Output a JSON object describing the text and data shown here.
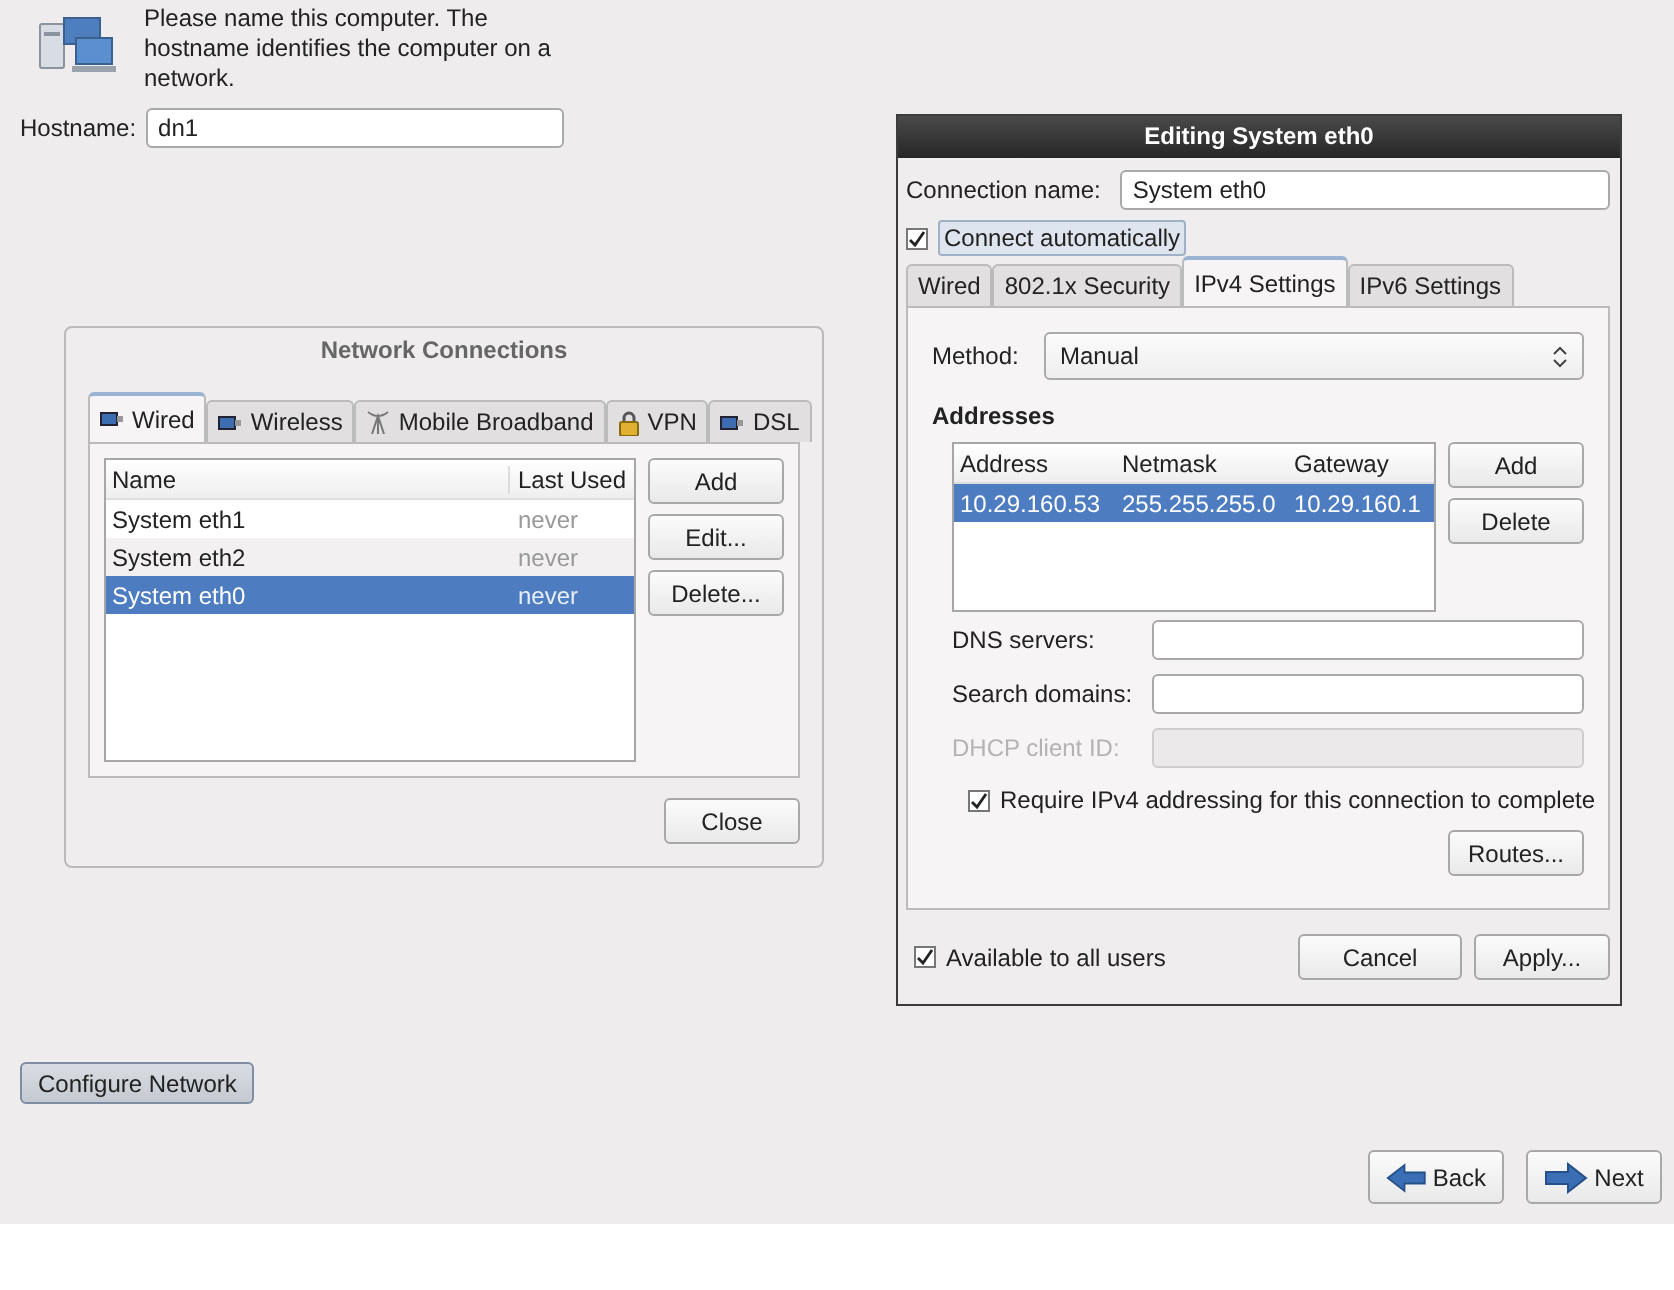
{
  "header": {
    "message": "Please name this computer.  The hostname identifies the computer on a network."
  },
  "hostname": {
    "label": "Hostname:",
    "value": "dn1"
  },
  "network_connections": {
    "title": "Network Connections",
    "tabs": [
      {
        "label": "Wired",
        "kind": "wired",
        "selected": true
      },
      {
        "label": "Wireless",
        "kind": "wireless",
        "selected": false
      },
      {
        "label": "Mobile Broadband",
        "kind": "mobile",
        "selected": false
      },
      {
        "label": "VPN",
        "kind": "vpn",
        "selected": false
      },
      {
        "label": "DSL",
        "kind": "dsl",
        "selected": false
      }
    ],
    "columns": [
      "Name",
      "Last Used"
    ],
    "rows": [
      {
        "name": "System eth1",
        "last_used": "never",
        "selected": false
      },
      {
        "name": "System eth2",
        "last_used": "never",
        "selected": false
      },
      {
        "name": "System eth0",
        "last_used": "never",
        "selected": true
      }
    ],
    "buttons": [
      "Add",
      "Edit...",
      "Delete..."
    ],
    "close_button": "Close"
  },
  "editing": {
    "title": "Editing System eth0",
    "connection_name": {
      "label": "Connection name:",
      "value": "System eth0"
    },
    "connect_automatically": {
      "label": "Connect automatically",
      "checked": true
    },
    "tabs": [
      {
        "label": "Wired",
        "selected": false
      },
      {
        "label": "802.1x Security",
        "selected": false
      },
      {
        "label": "IPv4 Settings",
        "selected": true
      },
      {
        "label": "IPv6 Settings",
        "selected": false
      }
    ],
    "method": {
      "label": "Method:",
      "value": "Manual"
    },
    "addresses_heading": "Addresses",
    "address_columns": [
      "Address",
      "Netmask",
      "Gateway"
    ],
    "address_rows": [
      {
        "address": "10.29.160.53",
        "netmask": "255.255.255.0",
        "gateway": "10.29.160.1",
        "selected": true
      }
    ],
    "address_buttons": [
      "Add",
      "Delete"
    ],
    "fields": [
      {
        "label": "DNS servers:",
        "disabled": false
      },
      {
        "label": "Search domains:",
        "disabled": false
      },
      {
        "label": "DHCP client ID:",
        "disabled": true
      }
    ],
    "require_ipv4": {
      "label": "Require IPv4 addressing for this connection to complete",
      "checked": true
    },
    "routes_button": "Routes...",
    "available_to_all": {
      "label": "Available to all users",
      "checked": true
    },
    "buttons": [
      "Cancel",
      "Apply..."
    ]
  },
  "configure_button": "Configure Network",
  "nav_buttons": [
    {
      "label": "Back",
      "kind": "back"
    },
    {
      "label": "Next",
      "kind": "next"
    }
  ]
}
